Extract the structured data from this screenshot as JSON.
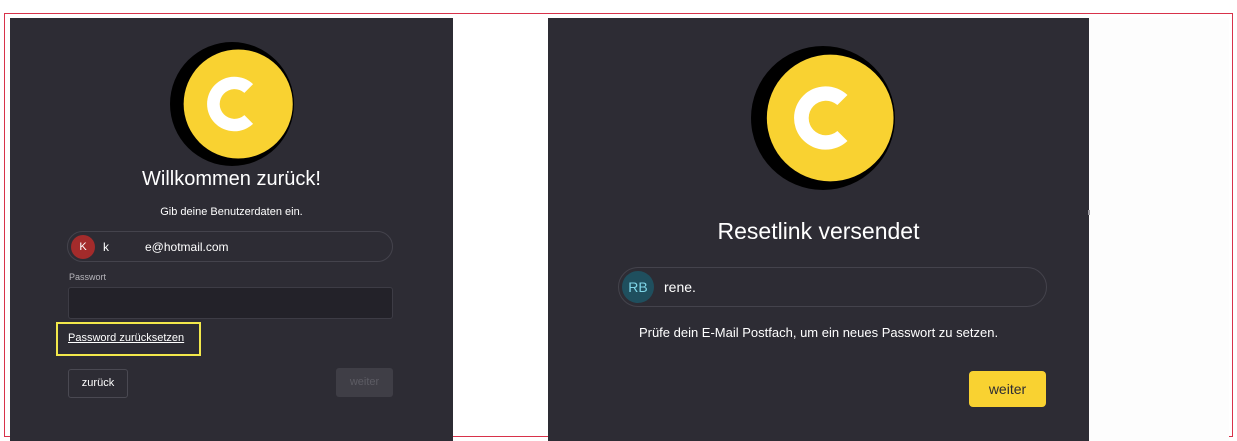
{
  "login_panel": {
    "title": "Willkommen zurück!",
    "subtitle": "Gib deine Benutzerdaten ein.",
    "account": {
      "avatar_initial": "K",
      "name_prefix": "k",
      "email": "e@hotmail.com",
      "avatar_color": "#a32b2b"
    },
    "password_label": "Passwort",
    "password_value": "",
    "reset_link_label": "Password zurücksetzen",
    "back_button_label": "zurück",
    "next_button_label": "weiter"
  },
  "reset_panel": {
    "title": "Resetlink versendet",
    "account": {
      "avatar_initials": "RB",
      "name": "rene.",
      "avatar_color": "#1f4f5e",
      "avatar_text_color": "#7fd6e8"
    },
    "message": "Prüfe dein E-Mail Postfach, um ein neues Passwort zu setzen.",
    "next_button_label": "weiter"
  },
  "colors": {
    "panel_bg": "#2d2c34",
    "accent_yellow": "#f9d231",
    "highlight_yellow": "#f2e84b",
    "frame_red": "#d8324a"
  },
  "icons": [
    "logo-icon"
  ]
}
